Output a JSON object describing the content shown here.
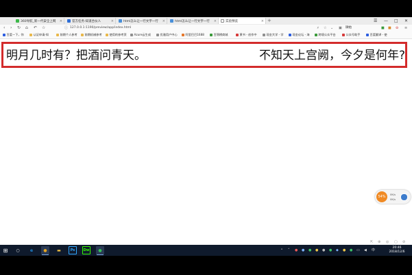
{
  "tabs": [
    {
      "label": "360导航_新一代安全上网",
      "favicon_color": "#3db84a",
      "active": false
    },
    {
      "label": "官方任务-知道合伙人",
      "favicon_color": "#2f6fd6",
      "active": false
    },
    {
      "label": "html怎么让一行文字一行",
      "favicon_color": "#4a90d9",
      "active": false
    },
    {
      "label": "html怎么让一行文字一行",
      "favicon_color": "#4a90d9",
      "active": false
    },
    {
      "label": "实验预览",
      "favicon_color": "#ffffff",
      "active": true
    }
  ],
  "tab_close": "×",
  "new_tab": "+",
  "window_controls": {
    "menu": "☰",
    "minimize": "—",
    "maximize": "□",
    "close": "✕"
  },
  "address_bar": {
    "back": "‹",
    "forward": "›",
    "reload": "↻",
    "home": "⌂",
    "undo": "↶",
    "star": "☆",
    "url": "127.0.0.1:1190/preview/app/index.html"
  },
  "profile_label": "微帕",
  "bookmarks": [
    {
      "label": "百度一下，你",
      "icon_color": "#2d5ee0"
    },
    {
      "label": "认证申请-知",
      "icon_color": "#e9b84a"
    },
    {
      "label": "前期个人参考",
      "icon_color": "#e9b84a"
    },
    {
      "label": "前期机械参考",
      "icon_color": "#e9b84a"
    },
    {
      "label": "使用的参考资",
      "icon_color": "#e9b84a"
    },
    {
      "label": "Azure云生成",
      "icon_color": "#8f8f8f"
    },
    {
      "label": "优雅用户中心",
      "icon_color": "#8f8f8f"
    },
    {
      "label": "阿里巴巴1688",
      "icon_color": "#e5772b"
    },
    {
      "label": "百锦绣商城",
      "icon_color": "#3a9a3a"
    },
    {
      "label": "黄书 - 创作中",
      "icon_color": "#d63a3a"
    },
    {
      "label": "现金大学 - 学",
      "icon_color": "#8f8f8f"
    },
    {
      "label": "现金论坛 - 海",
      "icon_color": "#2d5ee0"
    },
    {
      "label": "跨境公众平台",
      "icon_color": "#3a9a3a"
    },
    {
      "label": "公众号助手",
      "icon_color": "#d63a3a"
    },
    {
      "label": "百度翻译 - 使",
      "icon_color": "#2d5ee0"
    }
  ],
  "poem": {
    "left": "明月几时有？把酒问青天。",
    "right": "不知天上宫阙，今夕是何年?"
  },
  "widget": {
    "percent": "54%",
    "line1": "0K/s",
    "line2": "0K/s"
  },
  "taskbar": {
    "start": "⊞",
    "search": "○",
    "apps": [
      {
        "name": "edge",
        "glyph": "e",
        "color": "#1f8ad8"
      },
      {
        "name": "chrome",
        "glyph": "●",
        "color": "#e7a620"
      },
      {
        "name": "explorer",
        "glyph": "▬",
        "color": "#f2c240"
      },
      {
        "name": "photoshop",
        "glyph": "Ps",
        "color": "#31a8ff"
      },
      {
        "name": "dreamweaver",
        "glyph": "Dw",
        "color": "#35fa00"
      },
      {
        "name": "wechat",
        "glyph": "●",
        "color": "#35c45a"
      }
    ]
  },
  "clock": {
    "time": "20:46",
    "date": "2018/12/6"
  }
}
